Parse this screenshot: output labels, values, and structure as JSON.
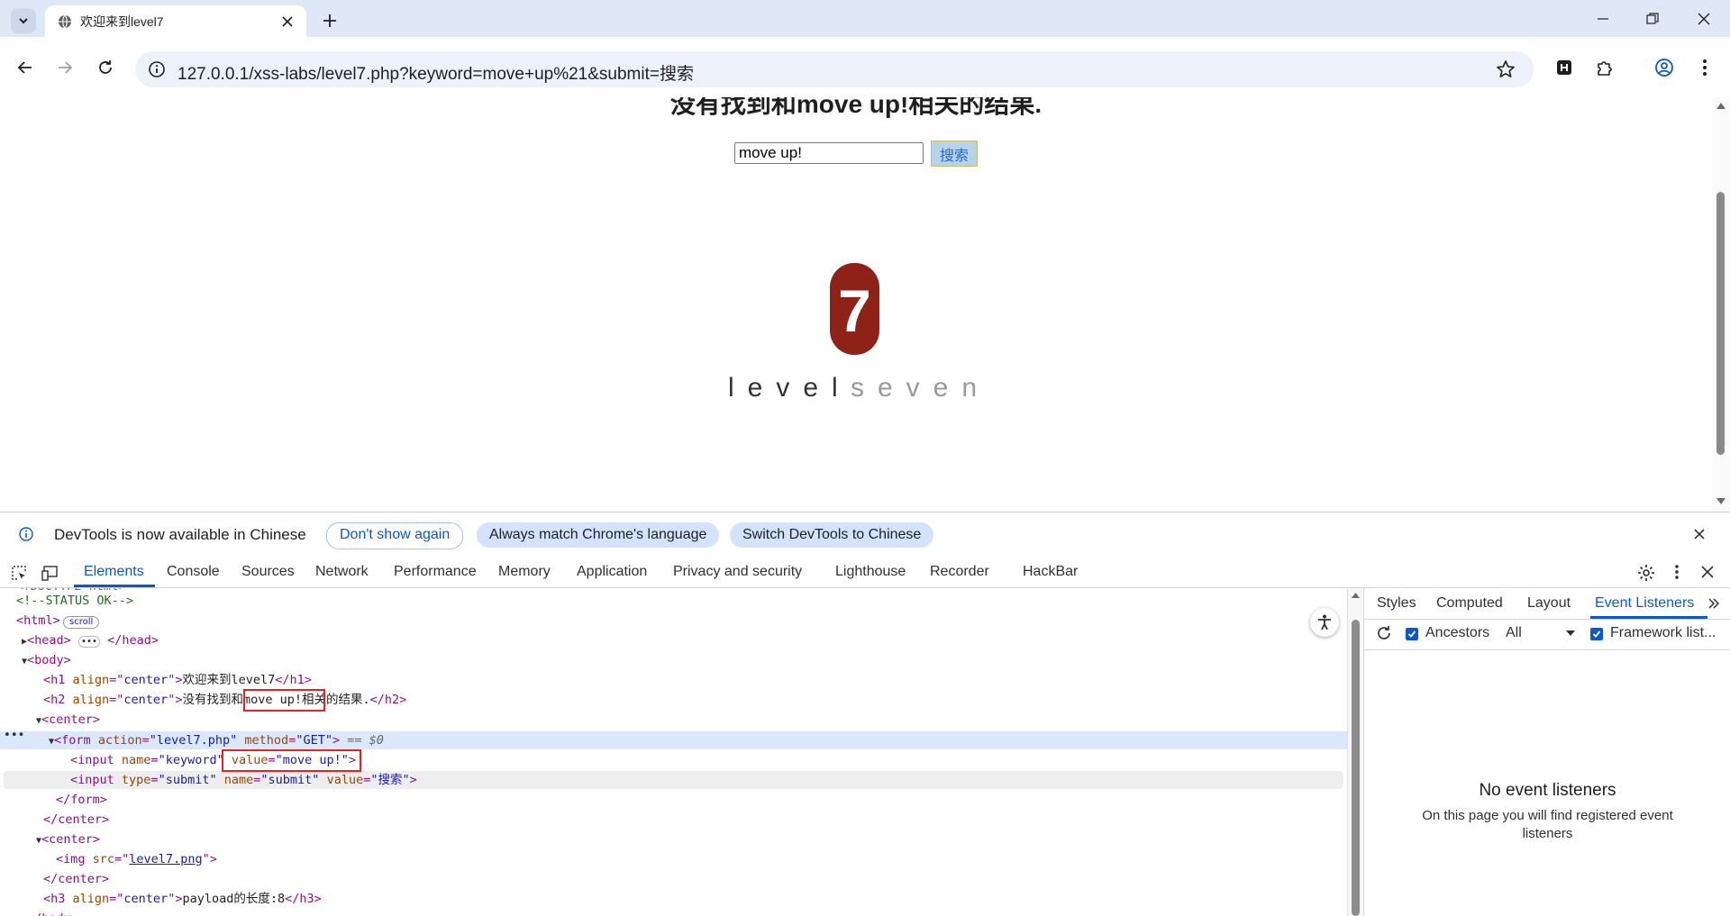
{
  "browser": {
    "tab_title": "欢迎来到level7",
    "url": "127.0.0.1/xss-labs/level7.php?keyword=move+up%21&submit=搜索"
  },
  "page": {
    "heading": "没有找到和move up!相关的结果.",
    "search_value": "move up!",
    "submit_label": "搜索",
    "logo_numeral": "7",
    "logo_word_dark": "level",
    "logo_word_light": "seven"
  },
  "devtools": {
    "infobar": {
      "message": "DevTools is now available in Chinese",
      "dont_show": "Don't show again",
      "always_match": "Always match Chrome's language",
      "switch": "Switch DevTools to Chinese"
    },
    "tabs": [
      "Elements",
      "Console",
      "Sources",
      "Network",
      "Performance",
      "Memory",
      "Application",
      "Privacy and security",
      "Lighthouse",
      "Recorder",
      "HackBar"
    ],
    "dom": {
      "doctype": "<!DOCTYPE html>",
      "comment": "<!--STATUS OK-->",
      "scroll_badge": "scroll",
      "h1_text": "欢迎来到level7",
      "h2_text_before": "没有找到和",
      "h2_text_highlight": "move up!",
      "h2_text_after": "相关的结果.",
      "form_action": "\"level7.php\"",
      "form_method": "\"GET\"",
      "selected_marker": "== $0",
      "input_name": "\"keyword\"",
      "input_value": "\"move up!\"",
      "submit_type": "\"submit\"",
      "submit_name": "\"submit\"",
      "submit_value": "\"搜索\"",
      "img_src": "level7.png",
      "h3_text": "payload的长度:8"
    },
    "side": {
      "tabs": [
        "Styles",
        "Computed",
        "Layout",
        "Event Listeners"
      ],
      "ancestors_label": "Ancestors",
      "filter_value": "All",
      "framework_label": "Framework list...",
      "empty_title": "No event listeners",
      "empty_subtitle": "On this page you will find registered event listeners"
    }
  },
  "colors": {
    "accent": "#0b57d0",
    "logo_red": "#8e2218",
    "highlight_box": "#e02424"
  }
}
